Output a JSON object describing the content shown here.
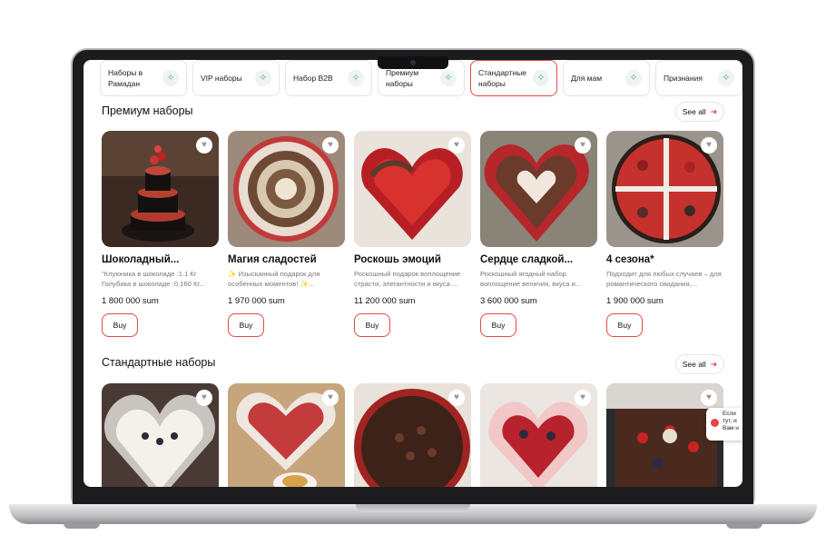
{
  "categories": [
    {
      "label": "Наборы в Рамадан",
      "active": false
    },
    {
      "label": "VIP наборы",
      "active": false
    },
    {
      "label": "Набор B2B",
      "active": false
    },
    {
      "label": "Премиум наборы",
      "active": false
    },
    {
      "label": "Стандартные наборы",
      "active": true
    },
    {
      "label": "Для мам",
      "active": false
    },
    {
      "label": "Признания",
      "active": false
    }
  ],
  "sections": [
    {
      "title": "Премиум наборы",
      "see_all": "See all",
      "products": [
        {
          "name": "Шоколадный...",
          "desc": "\"Клуюника в шоколаде :1.1 Кг Голубика в шоколаде :0.160 Кг...",
          "price": "1 800 000 sum",
          "buy": "Buy"
        },
        {
          "name": "Магия сладостей",
          "desc": "✨ Изысканный подарок для особенных моментов! ✨...",
          "price": "1 970 000 sum",
          "buy": "Buy"
        },
        {
          "name": "Роскошь эмоций",
          "desc": "Роскошный подарок воплощение страсти, элегантности и вкуса ...",
          "price": "11 200 000 sum",
          "buy": "Buy"
        },
        {
          "name": "Сердце сладкой...",
          "desc": "Роскошный ягодный набор воплощение величия, вкуса и...",
          "price": "3 600 000 sum",
          "buy": "Buy"
        },
        {
          "name": "4 сезона*",
          "desc": "Подходит для любых случаев – для романтического свидания,...",
          "price": "1 900 000 sum",
          "buy": "Buy"
        }
      ]
    },
    {
      "title": "Стандартные наборы",
      "see_all": "See all"
    }
  ],
  "chat_bubble": {
    "line1": "Если",
    "line2": "тут, и",
    "line3": "Вам н"
  },
  "colors": {
    "accent": "#e74646",
    "chip_icon_bg": "#eef4f1",
    "chip_icon": "#6aa890"
  },
  "icons": {
    "chip": "sparkle-icon",
    "favorite": "heart-icon",
    "see_all": "arrow-right-icon"
  }
}
